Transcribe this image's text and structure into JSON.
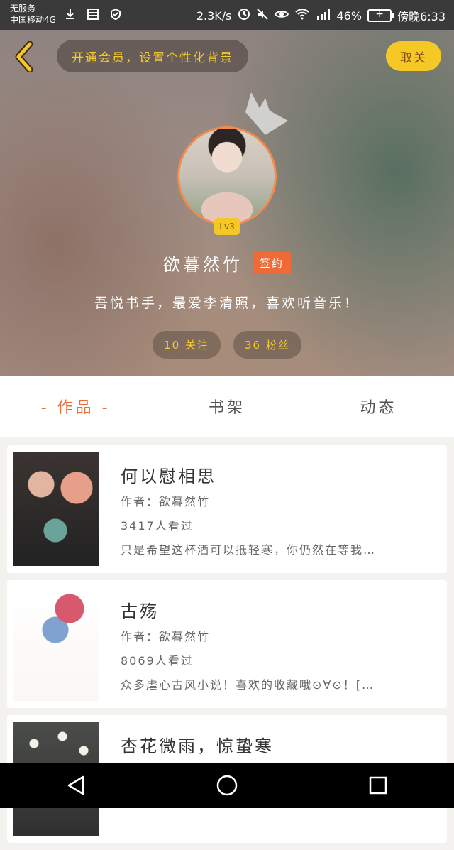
{
  "status_bar": {
    "carrier_line1": "无服务",
    "carrier_line2": "中国移动4G",
    "speed": "2.3K/s",
    "battery": "46%",
    "time": "傍晚6:33"
  },
  "header": {
    "vip_banner": "开通会员，设置个性化背景",
    "follow_button": "取关",
    "level": "Lv3",
    "username": "欲暮然竹",
    "sign_badge": "签约",
    "bio": "吾悦书手，最爱李清照，喜欢听音乐！",
    "following": "10 关注",
    "followers": "36 粉丝"
  },
  "tabs": [
    {
      "label": "- 作品 -",
      "active": true
    },
    {
      "label": "书架",
      "active": false
    },
    {
      "label": "动态",
      "active": false
    }
  ],
  "works": [
    {
      "title": "何以慰相思",
      "author": "作者：欲暮然竹",
      "views": "3417人看过",
      "desc": "只是希望这杯酒可以抵轻寒，你仍然在等我…"
    },
    {
      "title": "古殇",
      "author": "作者：欲暮然竹",
      "views": "8069人看过",
      "desc": "众多虐心古风小说！喜欢的收藏哦⊙∀⊙！[…"
    },
    {
      "title": "杏花微雨，惊蛰寒",
      "author": "",
      "views": "",
      "desc": ""
    }
  ],
  "colors": {
    "accent": "#ee6d35",
    "gold": "#f6c825"
  }
}
